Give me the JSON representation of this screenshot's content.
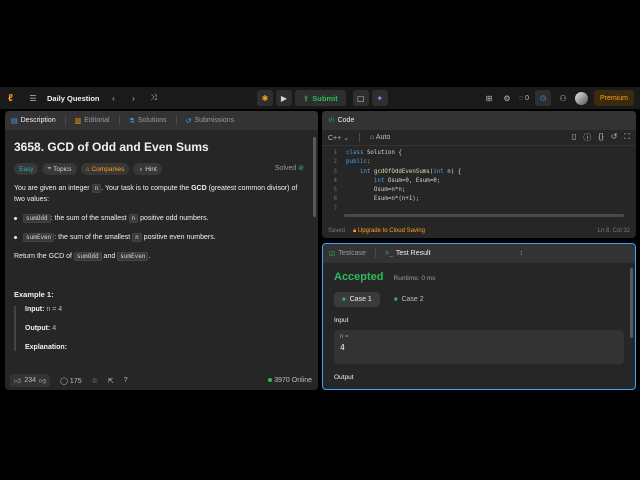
{
  "navbar": {
    "title": "Daily Question",
    "submit": "Submit",
    "streak": "0",
    "premium": "Premium"
  },
  "desc": {
    "tabs": [
      "Description",
      "Editorial",
      "Solutions",
      "Submissions"
    ],
    "title": "3658. GCD of Odd and Even Sums",
    "solved": "Solved",
    "tags": [
      "Easy",
      "Topics",
      "Companies",
      "Hint"
    ],
    "intro_pre": "You are given an integer ",
    "intro_code": "n",
    "intro_mid": ". Your task is to compute the ",
    "intro_bold": "GCD",
    "intro_post": " (greatest common divisor) of two values:",
    "b1_code": "sumOdd",
    "b1_pre": ": the sum of the smallest ",
    "b1_code2": "n",
    "b1_post": " positive odd numbers.",
    "b2_code": "sumEven",
    "b2_pre": ": the sum of the smallest ",
    "b2_code2": "n",
    "b2_post": " positive even numbers.",
    "ret_pre": "Return the GCD of ",
    "ret_code1": "sumOdd",
    "ret_mid": " and ",
    "ret_code2": "sumEven",
    "ret_post": ".",
    "example_title": "Example 1:",
    "ex_input_label": "Input:",
    "ex_input_val": "n = 4",
    "ex_output_label": "Output:",
    "ex_output_val": "4",
    "ex_expl_label": "Explanation:",
    "likes": "234",
    "comments": "175",
    "online": "3970 Online"
  },
  "code": {
    "tab": "Code",
    "lang": "C++",
    "mode": "Auto",
    "lines": [
      {
        "n": "1",
        "t": "class Solution {"
      },
      {
        "n": "2",
        "t": "public:"
      },
      {
        "n": "3",
        "t": "    int gcdOfOddEvenSums(int n) {"
      },
      {
        "n": "4",
        "t": "        int Osum=0, Esum=0;"
      },
      {
        "n": "5",
        "t": "        Osum=n*n;"
      },
      {
        "n": "6",
        "t": "        Esum=n*(n+1);"
      },
      {
        "n": "7",
        "t": ""
      }
    ],
    "saved": "Saved",
    "upgrade": "Upgrade to Cloud Saving",
    "cursor": "Ln 8, Col 32"
  },
  "result": {
    "tab1": "Testcase",
    "tab2": "Test Result",
    "status": "Accepted",
    "runtime": "Runtime: 0 ms",
    "case1": "Case 1",
    "case2": "Case 2",
    "input_label": "Input",
    "var_name": "n =",
    "var_value": "4",
    "output_label": "Output"
  }
}
